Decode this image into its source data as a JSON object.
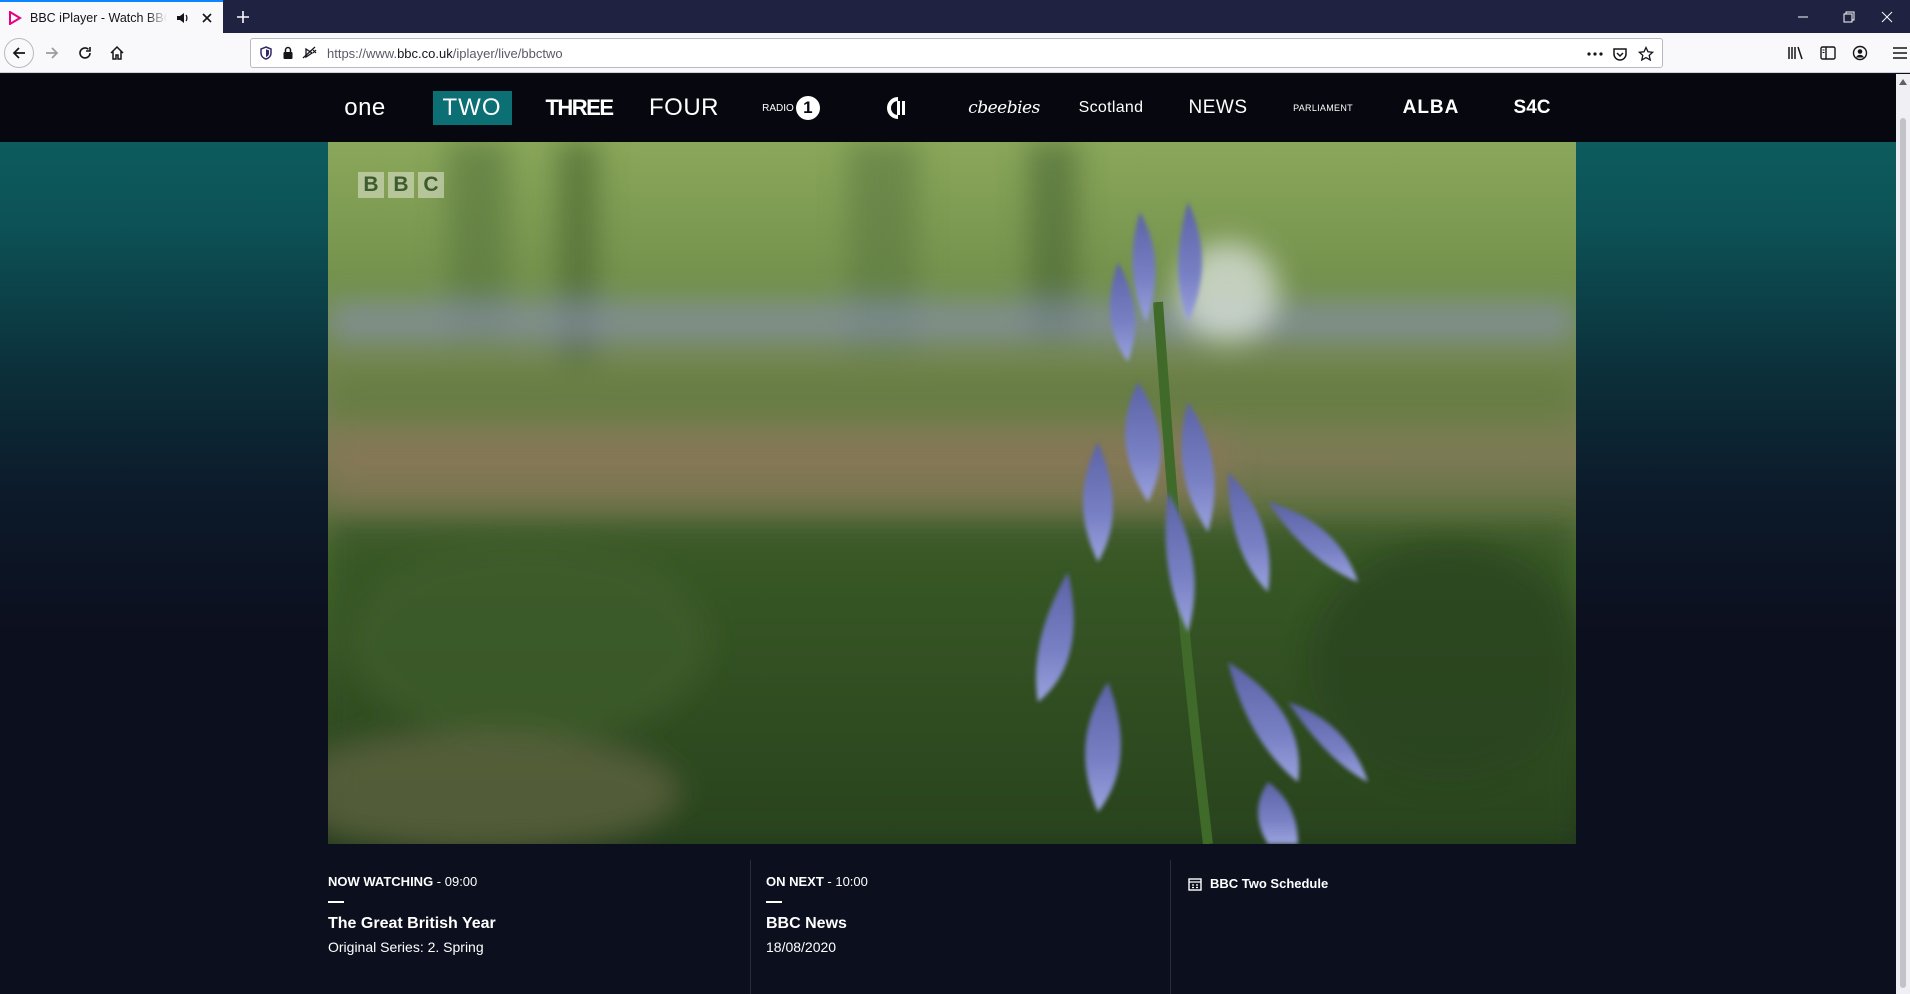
{
  "browser": {
    "tab_title": "BBC iPlayer - Watch BBC Two live",
    "url_prefix": "https://www.",
    "url_host": "bbc.co.uk",
    "url_path": "/iplayer/live/bbctwo"
  },
  "channels": {
    "one": "one",
    "two": "TWO",
    "three": "THREE",
    "four": "FOUR",
    "radio1_word": "RADIO",
    "radio1_num": "1",
    "cbeebies": "cbeebies",
    "scotland": "Scotland",
    "news": "NEWS",
    "parliament": "PARLIAMENT",
    "alba": "ALBA",
    "s4c": "S4C"
  },
  "player": {
    "logo_letters": [
      "B",
      "B",
      "C"
    ]
  },
  "now": {
    "label": "NOW WATCHING",
    "time": " - 09:00",
    "title": "The Great British Year",
    "subtitle": "Original Series: 2. Spring"
  },
  "next": {
    "label": "ON NEXT",
    "time": " - 10:00",
    "title": "BBC News",
    "subtitle": "18/08/2020"
  },
  "schedule": {
    "label": "BBC Two Schedule"
  },
  "colors": {
    "accent_teal": "#0b6f73",
    "channel_bar": "#07080f",
    "page_bg": "#0c0f1e"
  }
}
